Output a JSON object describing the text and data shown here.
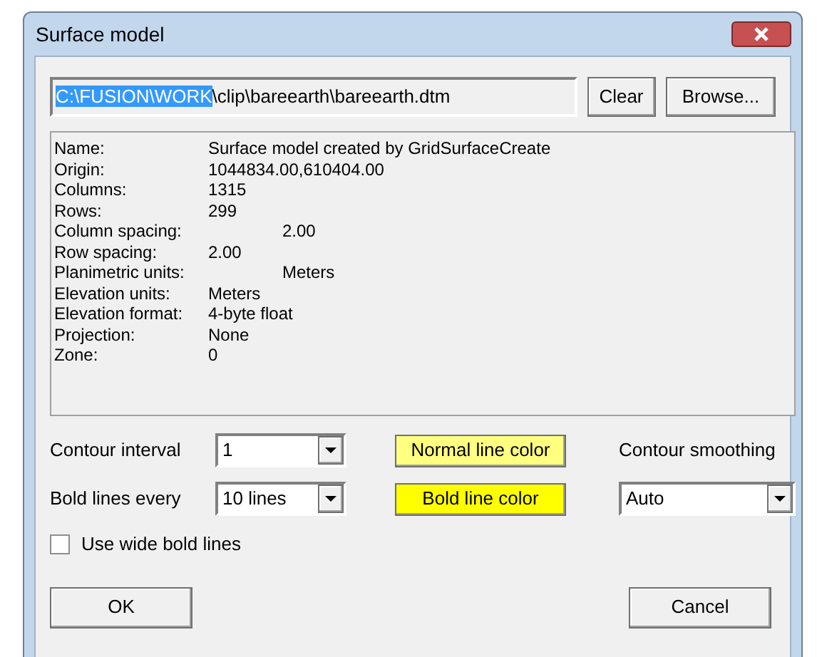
{
  "window": {
    "title": "Surface model"
  },
  "path": {
    "selected_part": "C:\\FUSION\\WORK",
    "rest": "\\clip\\bareearth\\bareearth.dtm"
  },
  "path_buttons": [
    "Clear",
    "Browse..."
  ],
  "info": [
    {
      "label": "Name:",
      "value": "Surface model created by GridSurfaceCreate"
    },
    {
      "label": "Origin:",
      "value": "1044834.00,610404.00"
    },
    {
      "label": "Columns:",
      "value": "1315"
    },
    {
      "label": "Rows:",
      "value": "299"
    },
    {
      "label": "Column spacing:",
      "value": "2.00"
    },
    {
      "label": "Row spacing:",
      "value": "2.00"
    },
    {
      "label": "Planimetric units:",
      "value": "Meters"
    },
    {
      "label": "Elevation units:",
      "value": "Meters"
    },
    {
      "label": "Elevation format:",
      "value": "4-byte float"
    },
    {
      "label": "Projection:",
      "value": "None"
    },
    {
      "label": "Zone:",
      "value": "0"
    }
  ],
  "contour_interval": {
    "label": "Contour interval",
    "value": "1"
  },
  "bold_lines_every": {
    "label": "Bold lines every",
    "value": "10 lines"
  },
  "normal_line_color": {
    "label": "Normal line color",
    "color": "#ffff80"
  },
  "bold_line_color": {
    "label": "Bold line color",
    "color": "#ffff00"
  },
  "contour_smoothing": {
    "label": "Contour smoothing",
    "value": "Auto"
  },
  "wide_bold_lines": {
    "label": "Use wide bold lines",
    "checked": false
  },
  "buttons": [
    "OK",
    "Cancel"
  ]
}
